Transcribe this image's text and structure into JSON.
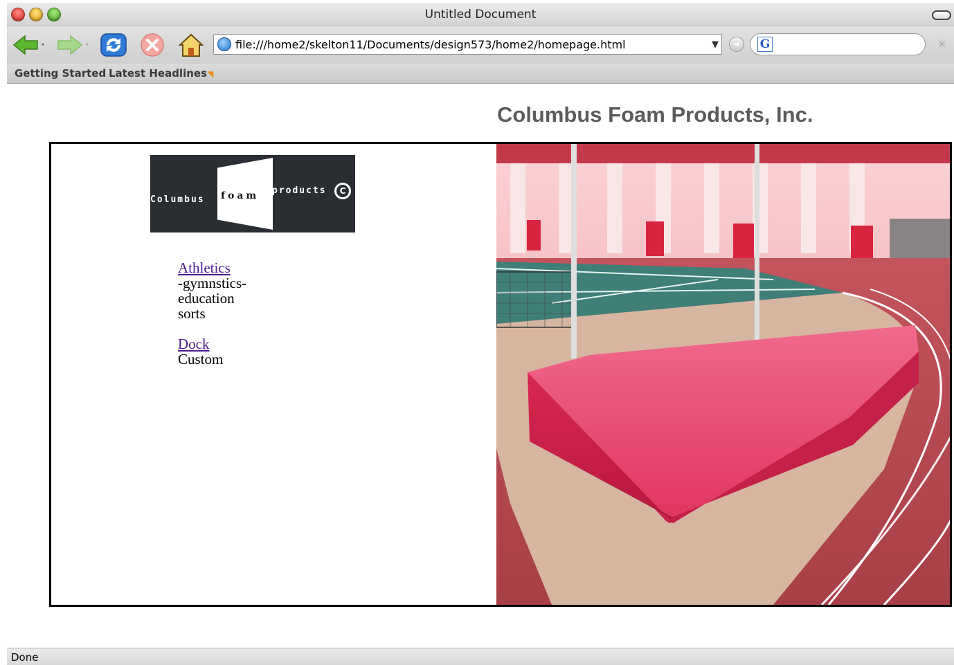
{
  "window": {
    "title": "Untitled Document"
  },
  "toolbar": {
    "url": "file:///home2/skelton11/Documents/design573/home2/homepage.html",
    "search_value": ""
  },
  "bookmarks": {
    "items": [
      "Getting Started",
      "Latest Headlines"
    ]
  },
  "page": {
    "company_title": "Columbus Foam Products, Inc.",
    "logo": {
      "word1": "Columbus",
      "word2": "foam",
      "word3": "products"
    },
    "nav": {
      "athletics_link": "Athletics",
      "athletics_sub1": "-gymnstics-",
      "athletics_sub2": "education",
      "athletics_sub3": "sorts",
      "dock_link": "Dock",
      "custom": "Custom"
    },
    "photo_alt": "High jump landing pit on indoor track"
  },
  "status": {
    "text": "Done"
  },
  "colors": {
    "title_gray": "#5c5c5c",
    "link_visited": "#4b1a8c",
    "mat_pink": "#e0345f",
    "track_red": "#b9464e",
    "court_teal": "#3f7f78"
  },
  "icons": [
    "back-arrow-icon",
    "forward-arrow-icon",
    "reload-icon",
    "stop-icon",
    "home-icon",
    "globe-icon",
    "go-icon",
    "google-search-icon",
    "rss-icon",
    "activity-spinner-icon"
  ]
}
